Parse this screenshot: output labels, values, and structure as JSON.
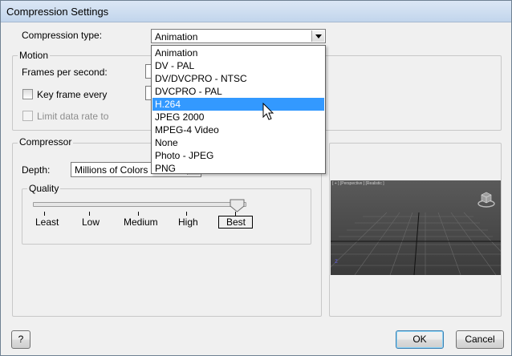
{
  "window": {
    "title": "Compression Settings"
  },
  "compression_type": {
    "label": "Compression type:",
    "value": "Animation",
    "options": [
      "Animation",
      "DV - PAL",
      "DV/DVCPRO - NTSC",
      "DVCPRO - PAL",
      "H.264",
      "JPEG 2000",
      "MPEG-4 Video",
      "None",
      "Photo - JPEG",
      "PNG"
    ],
    "highlighted": "H.264"
  },
  "motion": {
    "legend": "Motion",
    "fps_label": "Frames per second:",
    "keyframe_label": "Key frame every",
    "keyframe_checked": false,
    "limit_label": "Limit data rate to",
    "limit_checked": false
  },
  "compressor": {
    "legend": "Compressor",
    "depth_label": "Depth:",
    "depth_value": "Millions of Colors",
    "quality": {
      "legend": "Quality",
      "levels": [
        "Least",
        "Low",
        "Medium",
        "High",
        "Best"
      ],
      "selected": "Best",
      "value_fraction": 1.0
    }
  },
  "preview": {
    "viewport_text": "[ + ] [Perspective ] [Realistic ]"
  },
  "buttons": {
    "help": "?",
    "ok": "OK",
    "cancel": "Cancel"
  },
  "colors": {
    "selection": "#3399ff",
    "titlebar": "#c2d5ec"
  }
}
